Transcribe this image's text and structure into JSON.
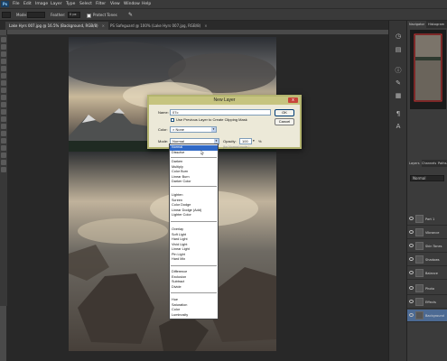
{
  "menubar": {
    "app_logo": "Ps",
    "items": [
      "File",
      "Edit",
      "Image",
      "Layer",
      "Type",
      "Select",
      "Filter",
      "View",
      "Window",
      "Help"
    ]
  },
  "options": {
    "mode_label": "Mode:",
    "mode_value": "Normal",
    "width_label": "Width:",
    "feather_label": "Feather:",
    "feather_value": "0 px",
    "protect_tones": "Protect Tones",
    "exposure_label": "Exposure:"
  },
  "tabs": [
    {
      "label": "Lake Hyrs 007.jpg @ 16.5% (Background, RGB/8)",
      "active": true
    },
    {
      "label": "PS Safeguard @ 100% (Lake Hyrs 007.jpg, RGB/8)",
      "active": false
    }
  ],
  "panels": {
    "top_tabs": [
      "Navigator",
      "Histogram"
    ],
    "layer_tabs": [
      "Layers",
      "Channels",
      "Paths"
    ],
    "blend_mode": "Normal",
    "layers": [
      {
        "name": "Part 1",
        "selected": false
      },
      {
        "name": "Vibrance",
        "selected": false
      },
      {
        "name": "Skin Tones",
        "selected": false
      },
      {
        "name": "Shadows",
        "selected": false
      },
      {
        "name": "Balance",
        "selected": false
      },
      {
        "name": "Photo",
        "selected": false
      },
      {
        "name": "Effects",
        "selected": false
      },
      {
        "name": "Background",
        "selected": true
      }
    ]
  },
  "dialog": {
    "title": "New Layer",
    "name_label": "Name:",
    "name_value": "07c",
    "clip_label": "Use Previous Layer to Create Clipping Mask",
    "color_label": "Color:",
    "color_value": "None",
    "mode_label": "Mode:",
    "mode_value": "Normal",
    "opacity_label": "Opacity:",
    "opacity_value": "100",
    "opacity_unit": "%",
    "neutral_hint": "(for Normal mode.)",
    "ok_label": "OK",
    "cancel_label": "Cancel",
    "close_label": "x"
  },
  "blend_modes": [
    "Normal",
    "Dissolve",
    "Darken",
    "Multiply",
    "Color Burn",
    "Linear Burn",
    "Darker Color",
    "Lighten",
    "Screen",
    "Color Dodge",
    "Linear Dodge (Add)",
    "Lighter Color",
    "Overlay",
    "Soft Light",
    "Hard Light",
    "Vivid Light",
    "Linear Light",
    "Pin Light",
    "Hard Mix",
    "Difference",
    "Exclusion",
    "Subtract",
    "Divide",
    "Hue",
    "Saturation",
    "Color",
    "Luminosity"
  ],
  "colors": {
    "app_bg": "#1f1f1f",
    "dialog_bg": "#ece9d8",
    "dialog_title": "#c6c47f",
    "selection": "#3169c6",
    "close_red": "#c8443a"
  }
}
